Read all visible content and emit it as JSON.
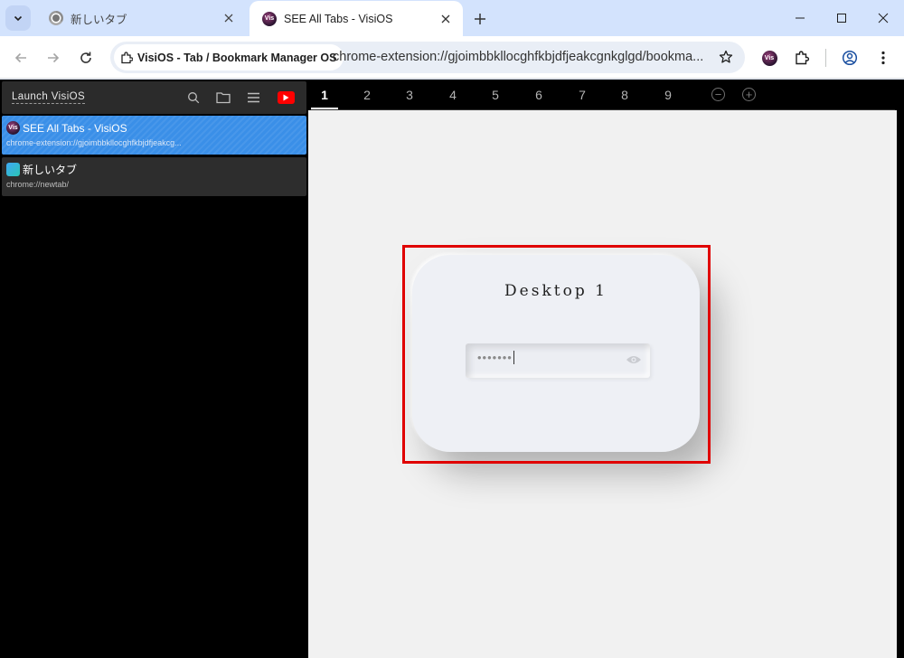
{
  "browser": {
    "tabs": [
      {
        "title": "新しいタブ",
        "active": false
      },
      {
        "title": "SEE All Tabs - VisiOS",
        "active": true
      }
    ],
    "site_chip": "VisiOS - Tab / Bookmark Manager OS",
    "url": "chrome-extension://gjoimbbkllocghfkbjdfjeakcgnkglgd/bookma...",
    "favicon_text": "Vis"
  },
  "sidebar": {
    "launch_label": "Launch VisiOS",
    "items": [
      {
        "title": "SEE All Tabs - VisiOS",
        "url": "chrome-extension://gjoimbbkllocghfkbjdfjeakcg...",
        "selected": true
      },
      {
        "title": "新しいタブ",
        "url": "chrome://newtab/",
        "selected": false
      }
    ]
  },
  "desktop_tabs": {
    "labels": [
      "1",
      "2",
      "3",
      "4",
      "5",
      "6",
      "7",
      "8",
      "9"
    ],
    "active": "1",
    "minus_symbol": "−",
    "plus_symbol": "+"
  },
  "lock_card": {
    "title": "Desktop 1",
    "password_mask": "•••••••"
  },
  "colors": {
    "highlight": "#e00000",
    "selected_item": "#3a8fe8",
    "youtube": "#ff0000"
  }
}
